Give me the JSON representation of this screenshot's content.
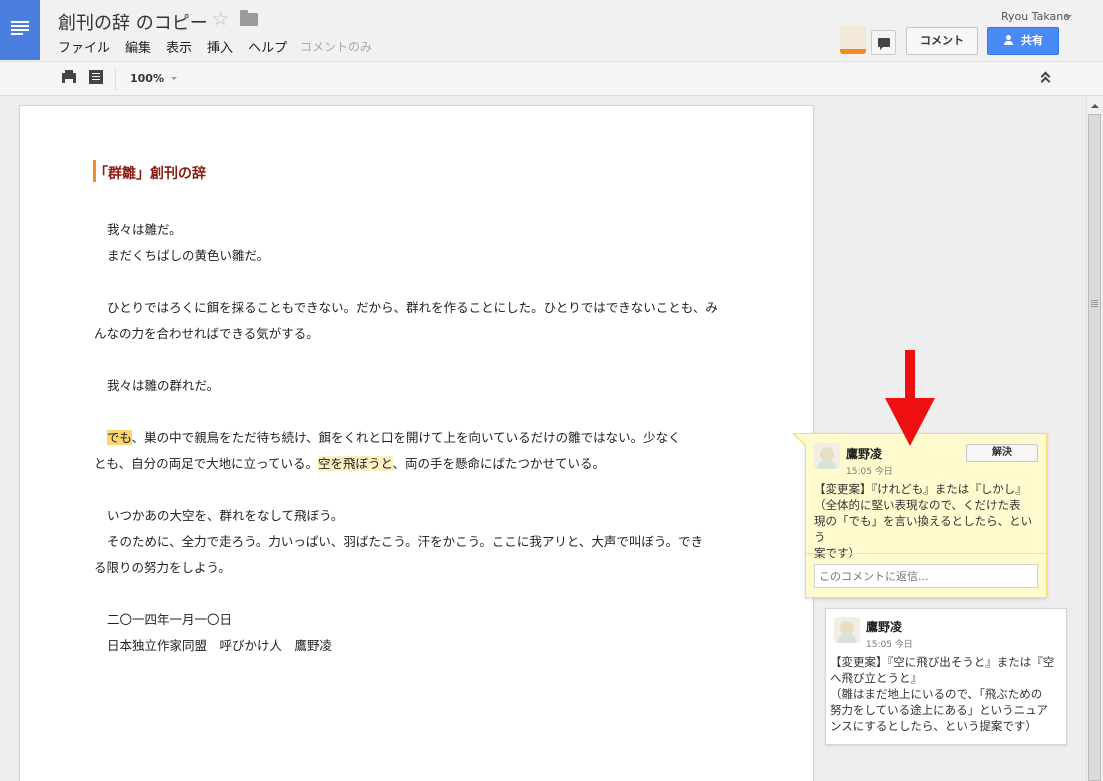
{
  "header": {
    "title": "創刊の辞 のコピー",
    "menu": [
      "ファイル",
      "編集",
      "表示",
      "挿入",
      "ヘルプ"
    ],
    "mode": "コメントのみ",
    "user_name": "Ryou Takano",
    "comment_label": "コメント",
    "share_label": "共有"
  },
  "toolbar": {
    "zoom": "100%"
  },
  "document": {
    "heading": "「群雛」創刊の辞",
    "line1": "我々は雛だ。",
    "line2": "まだくちばしの黄色い雛だ。",
    "line3": "ひとりではろくに餌を採ることもできない。だから、群れを作ることにした。ひとりではできないことも、み",
    "line4": "んなの力を合わせればできる気がする。",
    "line5": "我々は雛の群れだ。",
    "line6": {
      "hl1": "でも",
      "rest": "、巣の中で親鳥をただ待ち続け、餌をくれと口を開けて上を向いているだけの雛ではない。少なく"
    },
    "line7": {
      "pre": "とも、自分の両足で大地に立っている。",
      "hl2": "空を飛ぼうと",
      "post": "、両の手を懸命にばたつかせている。"
    },
    "line8": "いつかあの大空を、群れをなして飛ぼう。",
    "line9": "そのために、全力で走ろう。力いっぱい、羽ばたこう。汗をかこう。ここに我アリと、大声で叫ぼう。でき",
    "line10": "る限りの努力をしよう。",
    "date": "二〇一四年一月一〇日",
    "signature": "日本独立作家同盟　呼びかけ人　鷹野凌"
  },
  "comments": [
    {
      "author": "鷹野凌",
      "time": "15:05 今日",
      "body_line1": "【変更案】『けれども』または『しかし』",
      "body_line2": "（全体的に堅い表現なので、くだけた表",
      "body_line3": "現の「でも」を言い換えるとしたら、という",
      "body_line4": "案です）",
      "resolve_label": "解決",
      "reply_placeholder": "このコメントに返信..."
    },
    {
      "author": "鷹野凌",
      "time": "15:05 今日",
      "body_line1": "【変更案】『空に飛び出そうと』または『空",
      "body_line2": "へ飛び立とうと』",
      "body_line3": "（雛はまだ地上にいるので、「飛ぶための",
      "body_line4": "努力をしている途上にある」というニュア",
      "body_line5": "ンスにするとしたら、という提案です）"
    }
  ],
  "colors": {
    "logo_blue": "#4a7fe0",
    "share_blue": "#4a8af4",
    "heading_red": "#8b1a10",
    "highlight": "#fcd66a",
    "comment_bg": "#fffbcf",
    "arrow_red": "#ee1010"
  },
  "icons": [
    "docs-logo-icon",
    "star-icon",
    "folder-icon",
    "chat-icon",
    "print-icon",
    "paint-format-icon",
    "collapse-icon",
    "person-icon"
  ]
}
